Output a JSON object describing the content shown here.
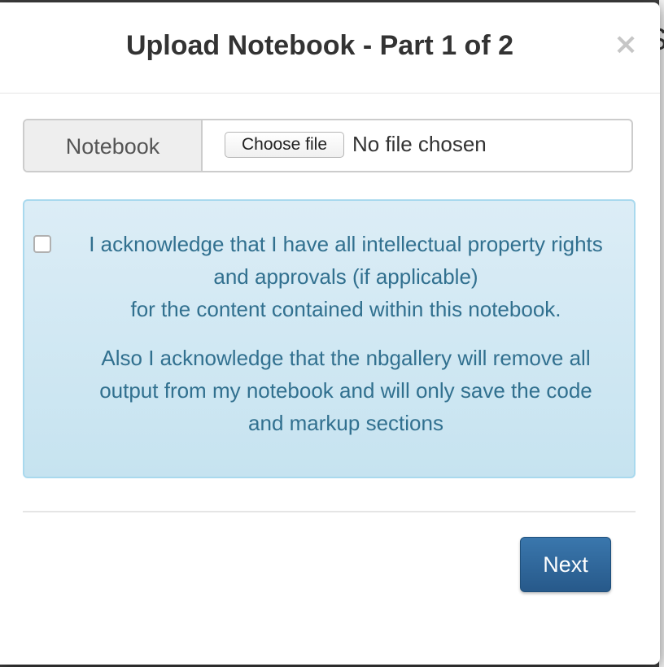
{
  "modal": {
    "title": "Upload Notebook - Part 1 of 2",
    "close_label": "×"
  },
  "file_input": {
    "addon_label": "Notebook",
    "button_label": "Choose file",
    "status": "No file chosen"
  },
  "acknowledgement": {
    "checked": false,
    "line1": "I acknowledge that I have all intellectual property rights",
    "line2": "and approvals (if applicable)",
    "line3": "for the content contained within this notebook.",
    "para2_line1": "Also I acknowledge that the nbgallery will remove all",
    "para2_line2": "output from my notebook and will only save the code",
    "para2_line3": "and markup sections"
  },
  "footer": {
    "next_label": "Next"
  },
  "colors": {
    "alert_text": "#31708f",
    "alert_background": "#d9edf7",
    "primary_button": "#337ab7"
  }
}
